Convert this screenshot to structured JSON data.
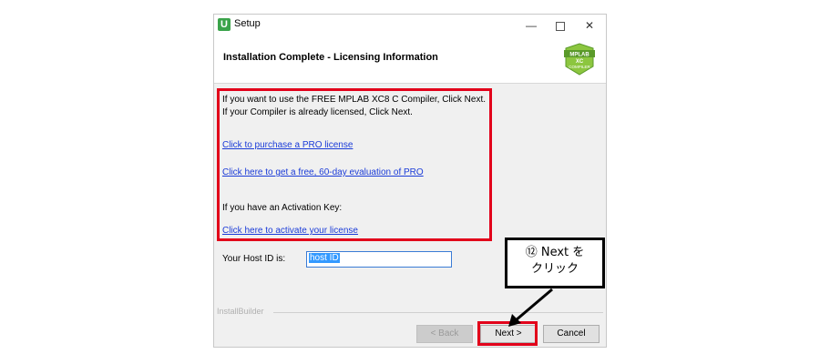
{
  "window": {
    "title": "Setup",
    "minimize_glyph": "—",
    "close_glyph": "✕"
  },
  "header": {
    "title": "Installation Complete - Licensing Information",
    "logo": {
      "line1": "MPLAB",
      "line2": "XC",
      "line3": "COMPILER"
    }
  },
  "content": {
    "line1": "If you want to use the FREE MPLAB XC8 C Compiler, Click Next.",
    "line2": "If your Compiler is already licensed, Click Next.",
    "link_purchase": "Click to purchase a PRO license",
    "link_evaluation": "Click here to get a free, 60-day evaluation of PRO",
    "activation_text": "If you have an Activation Key:",
    "link_activate": "Click here to activate your license"
  },
  "host": {
    "label": "Your Host ID is:",
    "value": "host ID"
  },
  "footer": {
    "brand": "InstallBuilder",
    "back_label": "< Back",
    "next_label": "Next >",
    "cancel_label": "Cancel"
  },
  "callout": {
    "line1": "⑫ Next を",
    "line2": "クリック"
  },
  "colors": {
    "highlight": "#e2001a",
    "link": "#1a3bd8",
    "logo_green": "#3aa34a"
  }
}
